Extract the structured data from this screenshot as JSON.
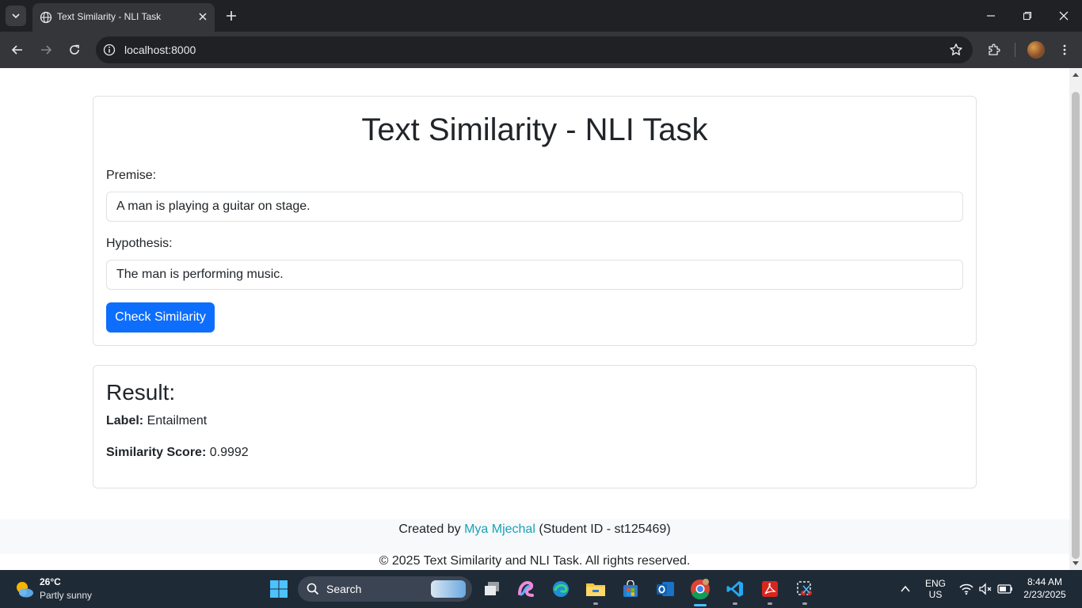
{
  "browser": {
    "tab_title": "Text Similarity - NLI Task",
    "url": "localhost:8000"
  },
  "page": {
    "title": "Text Similarity - NLI Task",
    "premise": {
      "label": "Premise:",
      "value": "A man is playing a guitar on stage."
    },
    "hypothesis": {
      "label": "Hypothesis:",
      "value": "The man is performing music."
    },
    "submit_label": "Check Similarity",
    "result": {
      "heading": "Result:",
      "label_key": "Label:",
      "label_value": "Entailment",
      "score_key": "Similarity Score:",
      "score_value": "0.9992"
    },
    "footer": {
      "created_by": "Created by",
      "author": "Mya Mjechal",
      "student_id": "(Student ID - st125469)",
      "copyright": "© 2025 Text Similarity and NLI Task. All rights reserved."
    }
  },
  "taskbar": {
    "weather_temp": "26°C",
    "weather_desc": "Partly sunny",
    "search_label": "Search",
    "lang_line1": "ENG",
    "lang_line2": "US",
    "time": "8:44 AM",
    "date": "2/23/2025"
  },
  "colors": {
    "primary_button": "#0d6efd",
    "link": "#17a2b8",
    "tabbar": "#202124",
    "toolbar": "#35363a",
    "taskbar": "#1f2a37"
  }
}
